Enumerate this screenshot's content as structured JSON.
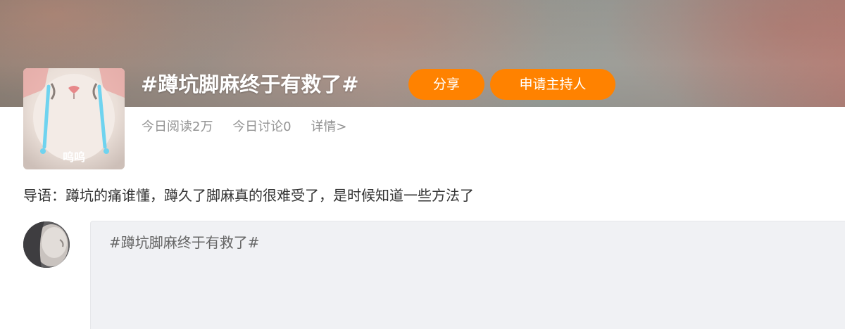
{
  "topic": {
    "title": "#蹲坑脚麻终于有救了#",
    "share_label": "分享",
    "host_label": "申请主持人",
    "reads_today": "今日阅读2万",
    "discussions_today": "今日讨论0",
    "details_label": "详情>",
    "avatar_caption": "呜呜",
    "accent_color": "#ff8200"
  },
  "guide": {
    "text": "导语：蹲坑的痛谁懂，蹲久了脚麻真的很难受了，是时候知道一些方法了"
  },
  "composer": {
    "value": "#蹲坑脚麻终于有救了#"
  }
}
